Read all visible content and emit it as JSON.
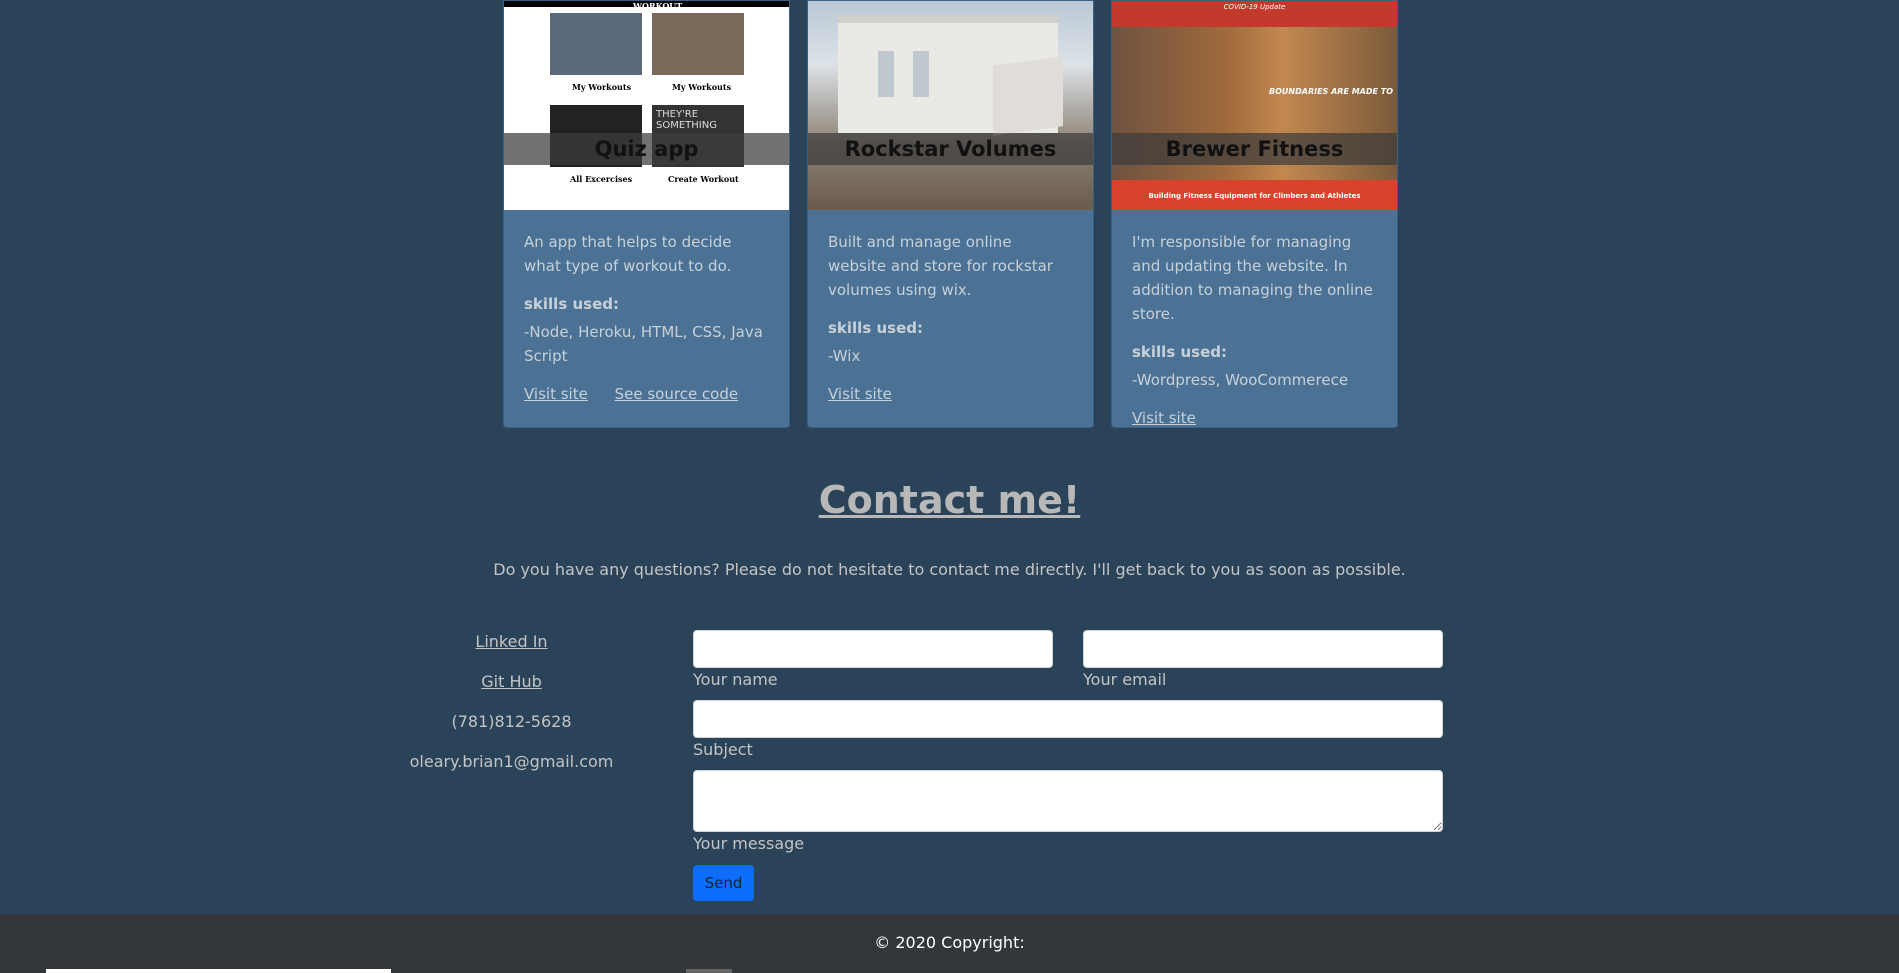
{
  "projects": [
    {
      "title": "Quiz app",
      "description": "An app that helps to decide what type of workout to do.",
      "skills_label": "skills used:",
      "skills": "-Node, Heroku, HTML, CSS, Java Script",
      "visit_label": "Visit site",
      "source_label": "See source code",
      "thumb": {
        "heading": "WORKOUT",
        "captions": [
          "My Workouts",
          "My Workouts",
          "All Excercises",
          "Create Workout"
        ],
        "tile3_text": "THEY'RE SOMETHING"
      }
    },
    {
      "title": "Rockstar Volumes",
      "description": "Built and manage online website and store for rockstar volumes using wix.",
      "skills_label": "skills used:",
      "skills": "-Wix",
      "visit_label": "Visit site"
    },
    {
      "title": "Brewer Fitness",
      "description": "I'm responsible for managing and updating the website. In addition to managing the online store.",
      "skills_label": "skills used:",
      "skills": "-Wordpress, WooCommerece",
      "visit_label": "Visit site",
      "thumb": {
        "top_text": "COVID-19 Update",
        "banner_text": "BOUNDARIES ARE MADE TO",
        "footer_text": "Building Fitness Equipment for Climbers and Athletes"
      }
    }
  ],
  "contact": {
    "title": "Contact me!",
    "subtitle": "Do you have any questions? Please do not hesitate to contact me directly. I'll get back to you as soon as possible.",
    "linkedin": "Linked In",
    "github": "Git Hub",
    "phone": "(781)812-5628",
    "email": "oleary.brian1@gmail.com"
  },
  "form": {
    "name_label": "Your name",
    "email_label": "Your email",
    "subject_label": "Subject",
    "message_label": "Your message",
    "send_label": "Send"
  },
  "footer": {
    "copyright": "© 2020 Copyright:"
  },
  "colors": {
    "background": "#2a4358",
    "card": "#4b7294",
    "footer": "#33363a",
    "send_button": "#0d6efd"
  }
}
